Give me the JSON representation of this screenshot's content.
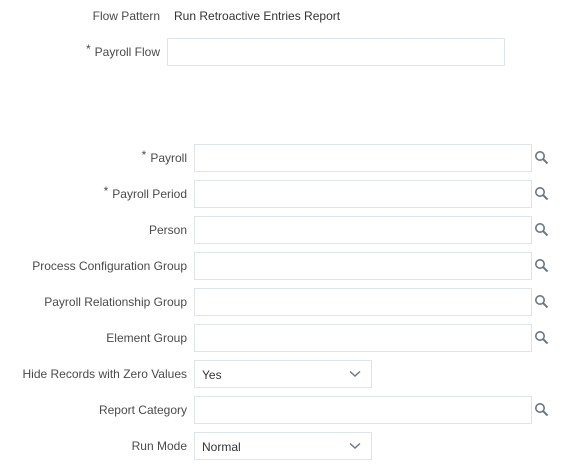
{
  "flow_pattern": {
    "label": "Flow Pattern",
    "value": "Run Retroactive Entries Report"
  },
  "payroll_flow": {
    "required_mark": "*",
    "label": "Payroll Flow",
    "value": ""
  },
  "parameters": {
    "payroll": {
      "required_mark": "*",
      "label": "Payroll",
      "value": ""
    },
    "payroll_period": {
      "required_mark": "*",
      "label": "Payroll Period",
      "value": ""
    },
    "person": {
      "label": "Person",
      "value": ""
    },
    "process_configuration_group": {
      "label": "Process Configuration Group",
      "value": ""
    },
    "payroll_relationship_group": {
      "label": "Payroll Relationship Group",
      "value": ""
    },
    "element_group": {
      "label": "Element Group",
      "value": ""
    },
    "hide_records_with_zero_values": {
      "label": "Hide Records with Zero Values",
      "selected": "Yes"
    },
    "report_category": {
      "label": "Report Category",
      "value": ""
    },
    "run_mode": {
      "label": "Run Mode",
      "selected": "Normal"
    }
  },
  "icons": {
    "search": "search-icon",
    "dropdown": "chevron-down-icon"
  },
  "colors": {
    "border": "#dfe4e8",
    "label": "#4a4a4a",
    "icon": "#6b7680"
  }
}
